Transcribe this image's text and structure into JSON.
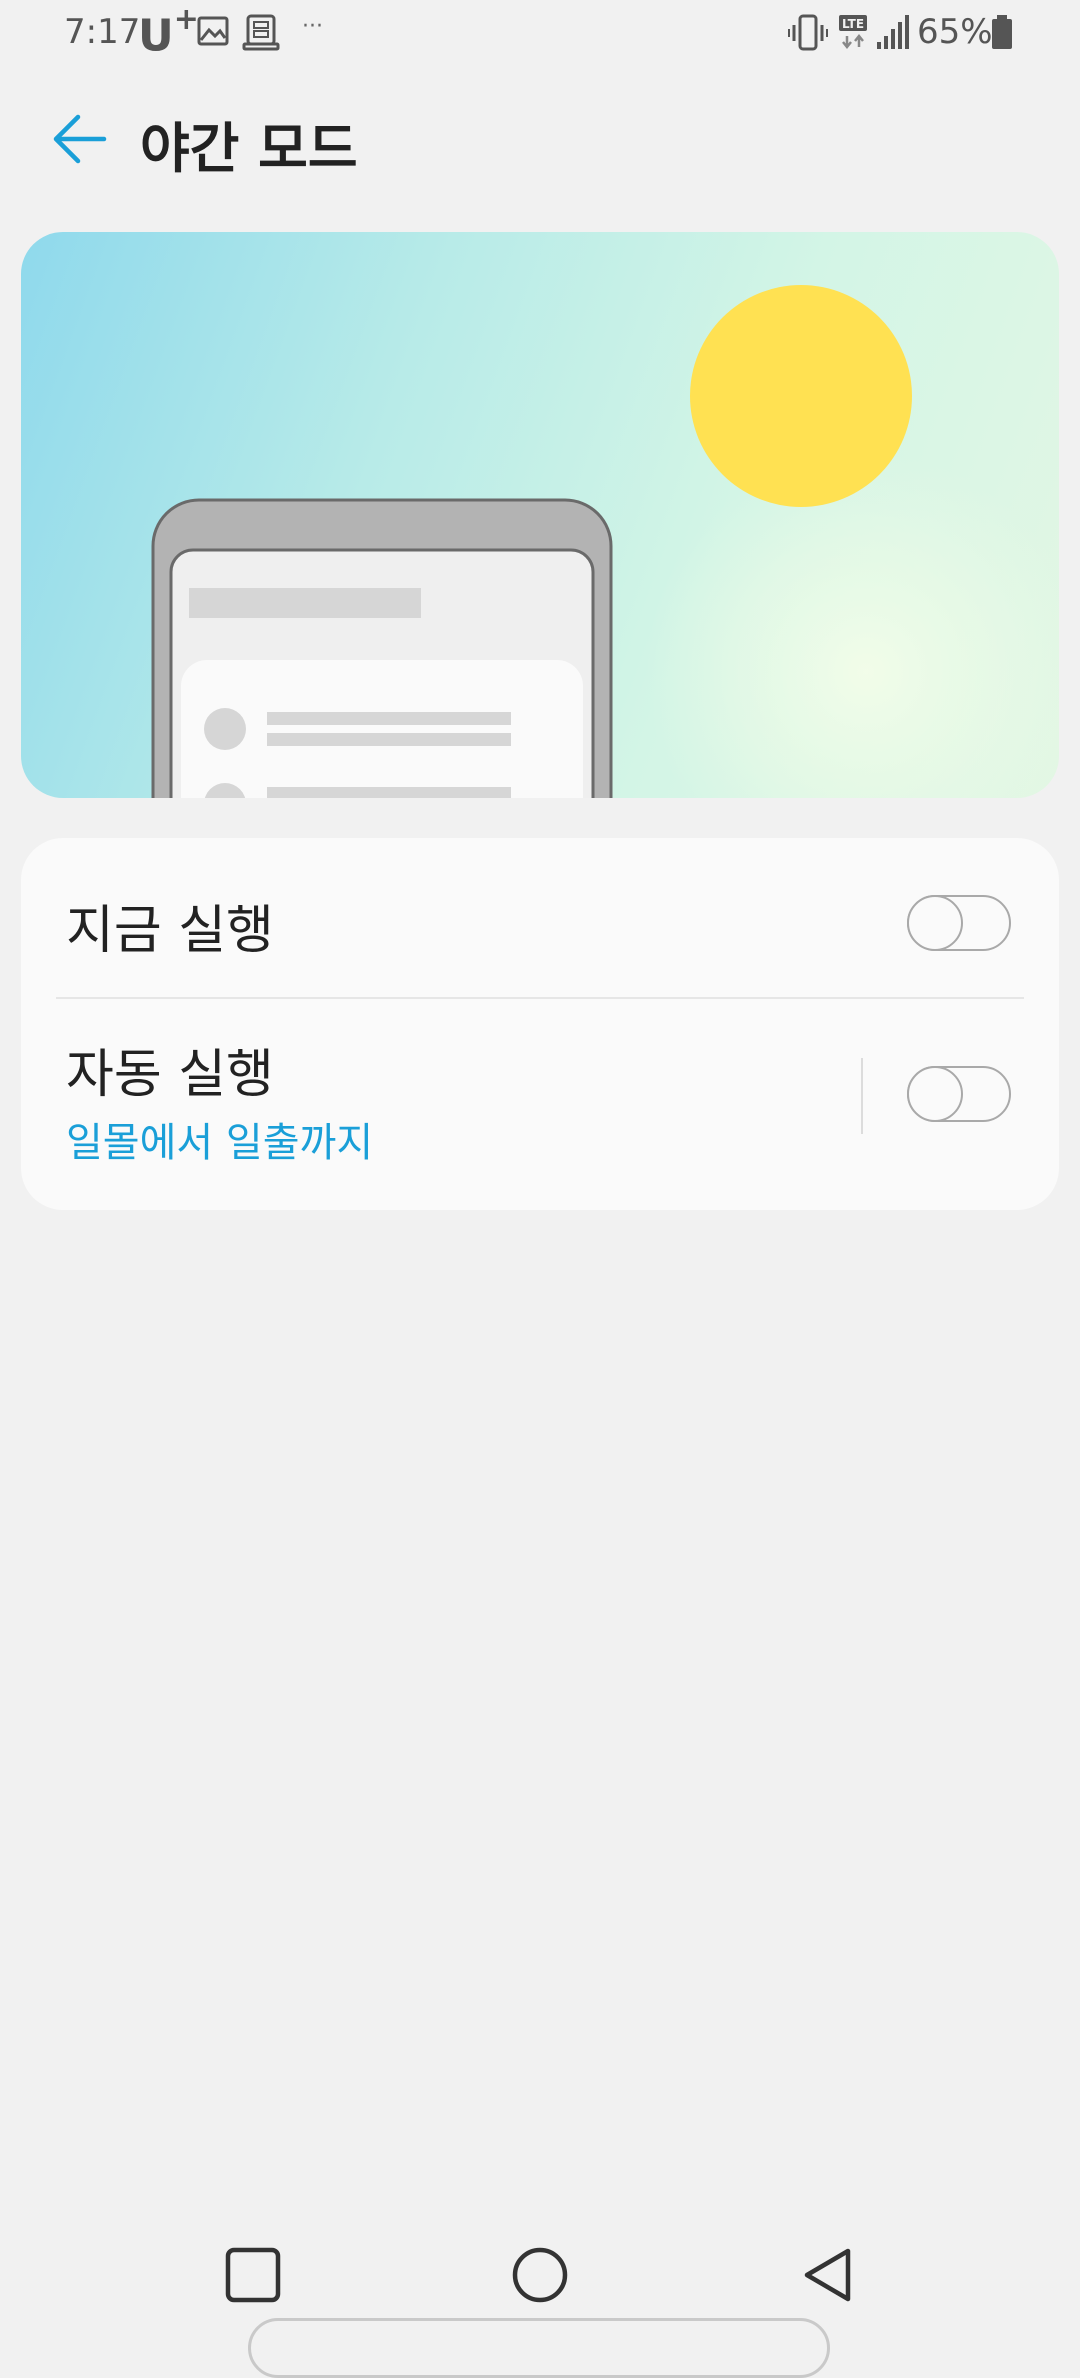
{
  "status_bar": {
    "time": "7:17",
    "carrier_main": "U",
    "carrier_plus": "+",
    "overflow_dots": "···",
    "network": "LTE",
    "battery": "65%"
  },
  "header": {
    "title": "야간 모드"
  },
  "settings": [
    {
      "title": "지금 실행",
      "enabled": false
    },
    {
      "title": "자동 실행",
      "subtitle": "일몰에서 일출까지",
      "enabled": false
    }
  ],
  "colors": {
    "accent": "#1a9fd8",
    "background": "#f1f1f1",
    "card": "#fafafa",
    "sun": "#ffe152"
  },
  "icons": {
    "back": "arrow-left-icon",
    "gallery": "image-icon",
    "notification": "printer-icon",
    "vibrate": "vibrate-icon",
    "lte": "lte-data-icon",
    "signal": "signal-icon",
    "battery": "battery-icon",
    "nav_recents": "square-icon",
    "nav_home": "circle-icon",
    "nav_back": "triangle-back-icon"
  }
}
